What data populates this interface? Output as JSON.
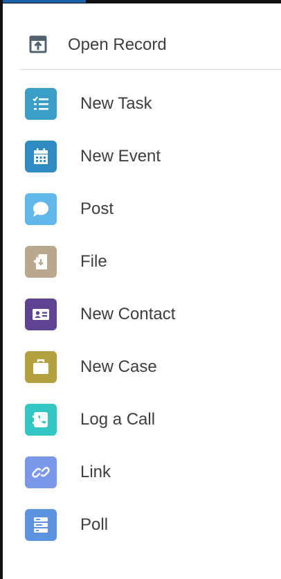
{
  "header": {
    "label": "Open Record",
    "icon": "open-record-icon"
  },
  "items": [
    {
      "label": "New Task",
      "icon": "task-icon",
      "color": "#3b9ec7"
    },
    {
      "label": "New Event",
      "icon": "event-icon",
      "color": "#2f8bc2"
    },
    {
      "label": "Post",
      "icon": "post-icon",
      "color": "#62b7ea"
    },
    {
      "label": "File",
      "icon": "file-icon",
      "color": "#b9a88e"
    },
    {
      "label": "New Contact",
      "icon": "contact-icon",
      "color": "#5e4392"
    },
    {
      "label": "New Case",
      "icon": "case-icon",
      "color": "#b3a03f"
    },
    {
      "label": "Log a Call",
      "icon": "call-icon",
      "color": "#33c6c3"
    },
    {
      "label": "Link",
      "icon": "link-icon",
      "color": "#7b97ea"
    },
    {
      "label": "Poll",
      "icon": "poll-icon",
      "color": "#5c93de"
    }
  ]
}
